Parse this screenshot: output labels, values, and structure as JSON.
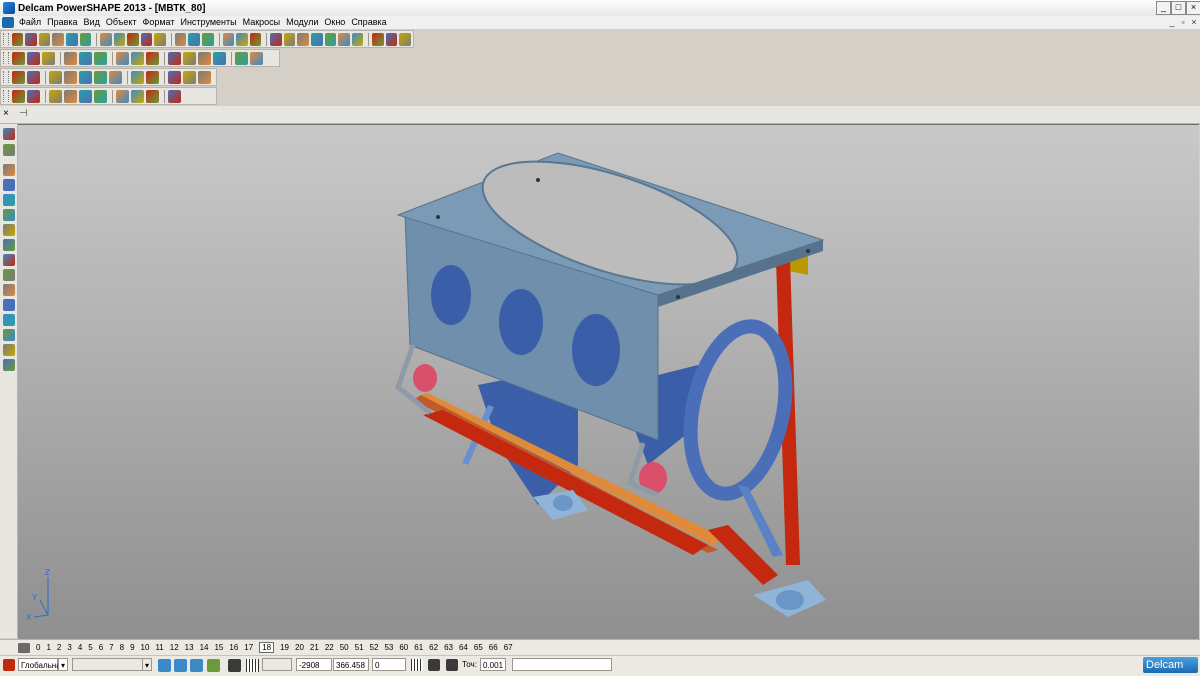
{
  "window": {
    "title": "Delcam PowerSHAPE 2013 - [МВТК_80]"
  },
  "menu": [
    "Файл",
    "Правка",
    "Вид",
    "Объект",
    "Формат",
    "Инструменты",
    "Макросы",
    "Модули",
    "Окно",
    "Справка"
  ],
  "toolbars": {
    "main": {
      "name": "main-toolbar"
    },
    "view": {
      "name": "view-toolbar"
    },
    "selection": {
      "name": "selection-toolbar"
    }
  },
  "level_bar": {
    "levels": [
      "0",
      "1",
      "2",
      "3",
      "4",
      "5",
      "6",
      "7",
      "8",
      "9",
      "10",
      "11",
      "12",
      "13",
      "14",
      "15",
      "16",
      "17",
      "18",
      "19",
      "20",
      "21",
      "22",
      "50",
      "51",
      "52",
      "53",
      "60",
      "61",
      "62",
      "63",
      "64",
      "65",
      "66",
      "67"
    ],
    "current": "18"
  },
  "status": {
    "workplane": "Глобальна",
    "x": "-2908",
    "y": "366.458",
    "z": "0",
    "tolerance_label": "Точ:",
    "tolerance": "0.001"
  },
  "brand": {
    "logo": "Delcam"
  },
  "triad": {
    "x": "X",
    "y": "Y",
    "z": "Z"
  },
  "colors": {
    "plate": "#6f8fac",
    "strut_red": "#c4280e",
    "strut_blue": "#4a6fb8",
    "yellow": "#c8a800",
    "orange": "#e08a3c",
    "pink": "#d8506a",
    "viewport_top": "#c9c9c9",
    "viewport_bottom": "#8f8f8f"
  }
}
